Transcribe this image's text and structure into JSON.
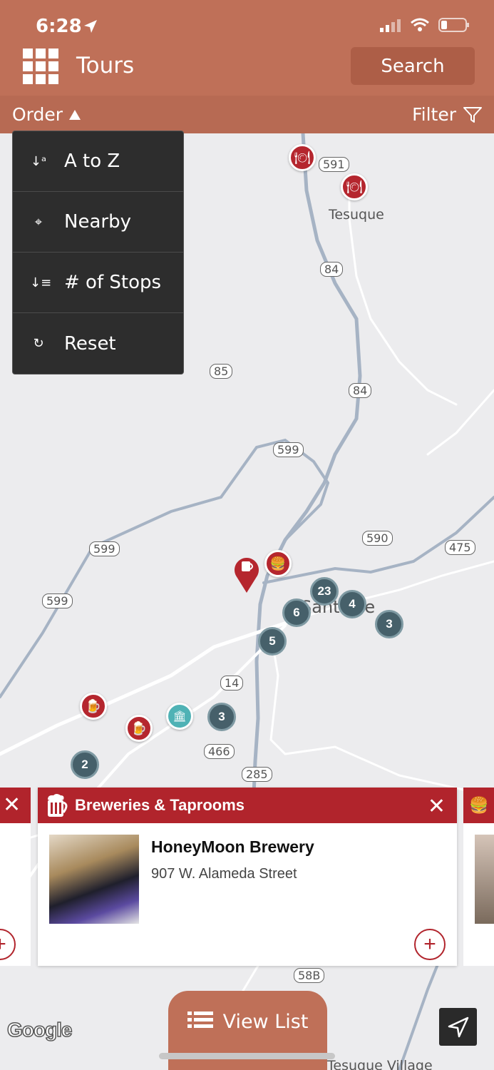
{
  "status": {
    "time": "6:28"
  },
  "header": {
    "title": "Tours",
    "search_label": "Search"
  },
  "subbar": {
    "order_label": "Order",
    "filter_label": "Filter"
  },
  "order_menu": {
    "items": [
      {
        "label": "A to Z",
        "icon": "sort-alpha-icon"
      },
      {
        "label": "Nearby",
        "icon": "crosshair-icon"
      },
      {
        "label": "# of Stops",
        "icon": "sort-number-icon"
      },
      {
        "label": "Reset",
        "icon": "reset-icon"
      }
    ]
  },
  "map": {
    "places": [
      "Tesuque",
      "Santa Fe",
      "Tesuque Village"
    ],
    "roads": [
      "591",
      "84",
      "85",
      "84",
      "599",
      "590",
      "475",
      "599",
      "599",
      "14",
      "466",
      "285",
      "58B"
    ],
    "clusters": [
      "23",
      "4",
      "6",
      "3",
      "5",
      "3",
      "2"
    ],
    "attribution": "Google"
  },
  "card": {
    "category": "Breweries & Taprooms",
    "name": "HoneyMoon Brewery",
    "address": "907 W. Alameda Street",
    "category_color": "#b1242c"
  },
  "bottom": {
    "view_list_label": "View List"
  },
  "colors": {
    "brand": "#bf7058",
    "cluster": "#46606a",
    "pin_red": "#b5262e",
    "pin_teal": "#4fb2b5"
  }
}
